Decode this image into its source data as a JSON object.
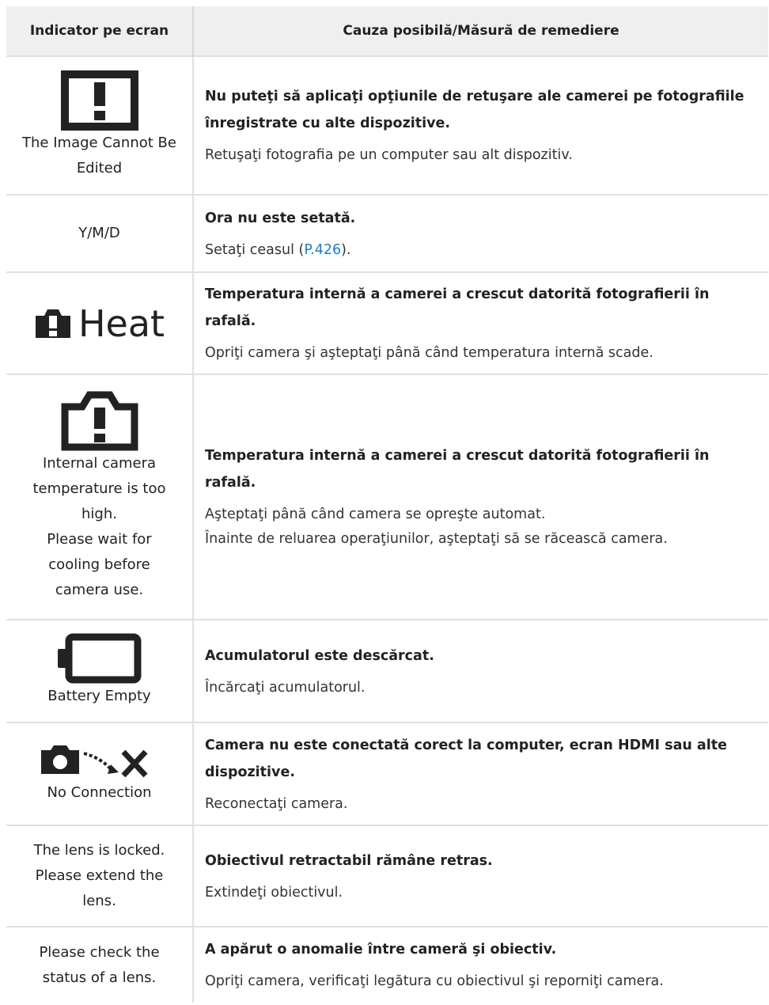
{
  "header": {
    "col1": "Indicator pe ecran",
    "col2": "Cauza posibilă/Măsură de remediere"
  },
  "rows": [
    {
      "indicator": "The Image Cannot Be Edited",
      "icon": "exclamation-box-icon",
      "title": "Nu puteţi să aplicaţi opţiunile de retuşare ale camerei pe fotografiile înregistrate cu alte dispozitive.",
      "text": "Retuşaţi fotografia pe un computer sau alt dispozitiv."
    },
    {
      "indicator": "Y/M/D",
      "title": "Ora nu este setată.",
      "text_before": "Setaţi ceasul (",
      "link": "P.426",
      "text_after": ")."
    },
    {
      "icon": "camera-warning-icon",
      "icon_label": "Heat",
      "title": "Temperatura internă a camerei a crescut datorită fotografierii în rafală.",
      "text": "Opriţi camera şi aşteptaţi până când temperatura internă scade."
    },
    {
      "icon": "camera-outline-warning-icon",
      "indicator_lines": [
        "Internal camera",
        "temperature is too",
        "high.",
        "Please wait for",
        "cooling before",
        "camera use."
      ],
      "title": "Temperatura internă a camerei a crescut datorită fotografierii în rafală.",
      "text_lines": [
        "Aşteptaţi până când camera se opreşte automat.",
        "Înainte de reluarea operaţiunilor, aşteptaţi să se răcească camera."
      ]
    },
    {
      "icon": "battery-empty-icon",
      "indicator": "Battery Empty",
      "title": "Acumulatorul este descărcat.",
      "text": "Încărcaţi acumulatorul."
    },
    {
      "icon": "no-connection-icon",
      "indicator": "No Connection",
      "title": "Camera nu este conectată corect la computer, ecran HDMI sau alte dispozitive.",
      "text": "Reconectaţi camera."
    },
    {
      "indicator_lines": [
        "The lens is locked.",
        "Please extend the",
        "lens."
      ],
      "title": "Obiectivul retractabil rămâne retras.",
      "text": "Extindeţi obiectivul."
    },
    {
      "indicator_lines": [
        "Please check the",
        "status of a lens."
      ],
      "title": "A apărut o anomalie între cameră şi obiectiv.",
      "text": "Opriţi camera, verificaţi legătura cu obiectivul şi reporniţi camera."
    }
  ]
}
